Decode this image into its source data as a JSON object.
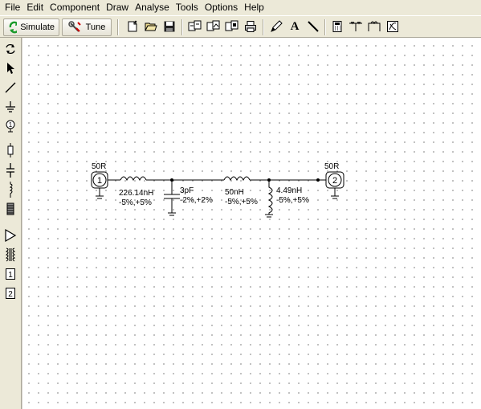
{
  "menu": [
    "File",
    "Edit",
    "Component",
    "Draw",
    "Analyse",
    "Tools",
    "Options",
    "Help"
  ],
  "toolbar": {
    "simulate_label": "Simulate",
    "tune_label": "Tune",
    "icons": [
      "new-icon",
      "open-icon",
      "save-icon",
      "copy-schematic-icon",
      "copy-graph-icon",
      "copy-both-icon",
      "print-icon",
      "pencil-icon",
      "text-icon",
      "line-icon",
      "calculator-icon",
      "t-network-icon",
      "pi-network-icon",
      "smith-icon"
    ],
    "text_icon_glyph": "A"
  },
  "left_tools": [
    "rotate-icon",
    "pointer-icon",
    "wire-icon",
    "ground-icon",
    "port-icon",
    "resistor-icon",
    "capacitor-icon",
    "inductor-icon",
    "tline-icon",
    "amplifier-icon",
    "transformer-icon",
    "port-1-icon",
    "port-2-icon"
  ],
  "left_tool_glyphs": {
    "port1": "1",
    "port2": "2"
  },
  "schematic": {
    "port1": {
      "number": "1",
      "impedance": "50R"
    },
    "port2": {
      "number": "2",
      "impedance": "50R"
    },
    "l1": {
      "value": "226.14nH",
      "tolerance": "-5%,+5%"
    },
    "c1": {
      "value": "3pF",
      "tolerance": "-2%,+2%"
    },
    "l2": {
      "value": "50nH",
      "tolerance": "-5%,+5%"
    },
    "l3": {
      "value": "4.49nH",
      "tolerance": "-5%,+5%"
    }
  }
}
